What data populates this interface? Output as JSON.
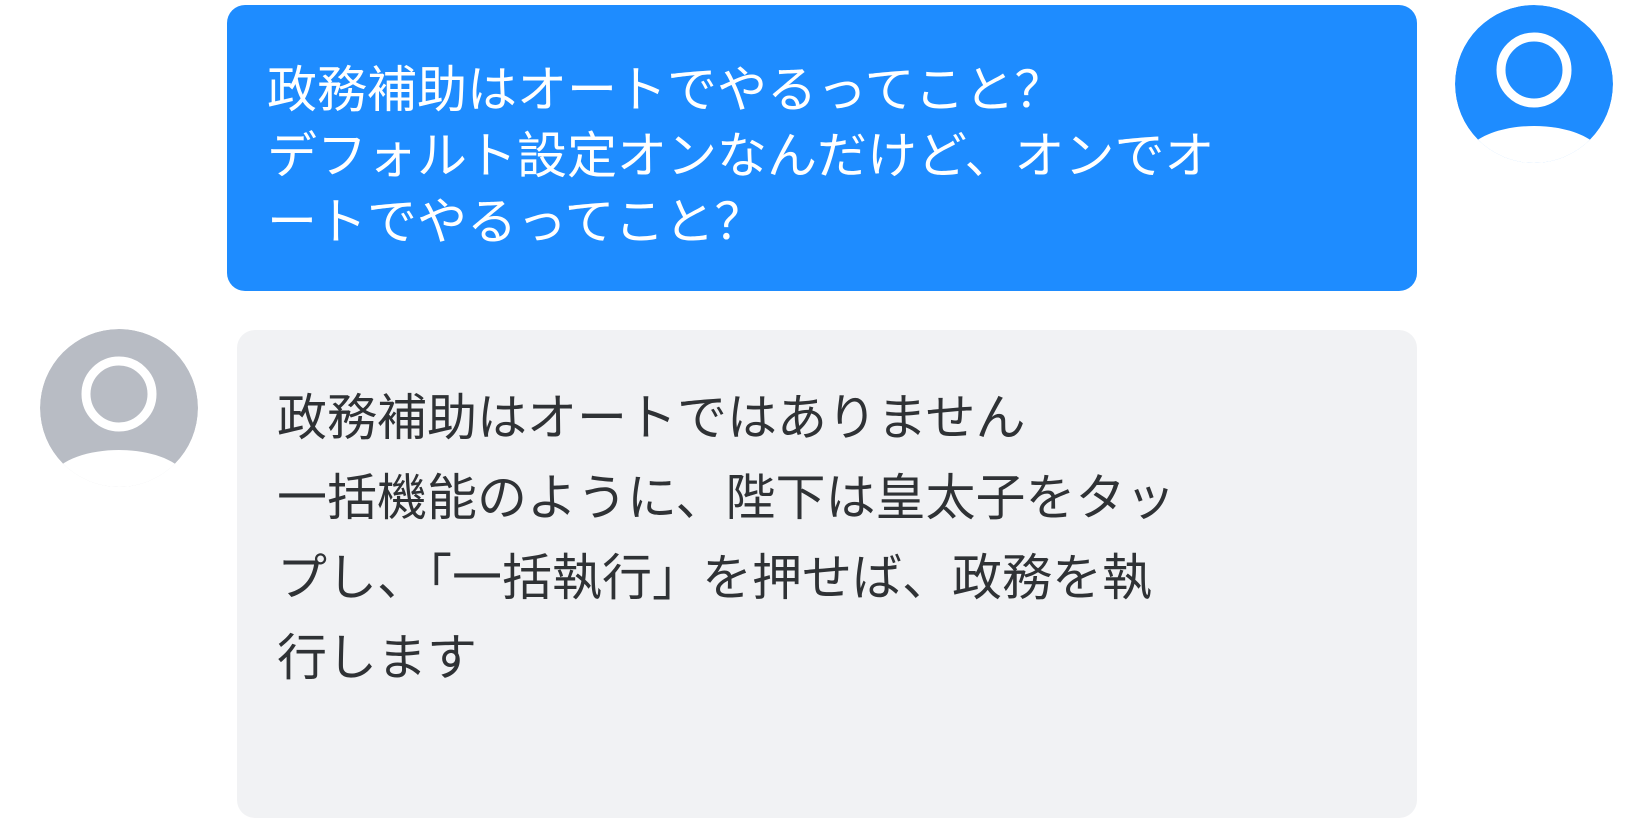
{
  "colors": {
    "user_bubble": "#1e8cff",
    "bot_bubble": "#f1f2f4",
    "user_avatar": "#1e8cff",
    "bot_avatar": "#b8bcc4"
  },
  "messages": [
    {
      "role": "user",
      "avatar_icon": "user-avatar-icon",
      "text": "政務補助はオートでやるってこと？\nデフォルト設定オンなんだけど、オンでオ\nートでやるってこと？"
    },
    {
      "role": "assistant",
      "avatar_icon": "user-avatar-icon",
      "text": "政務補助はオートではありません\n一括機能のように、陛下は皇太子をタッ\nプし、「一括執行」を押せば、政務を執\n行します"
    }
  ]
}
